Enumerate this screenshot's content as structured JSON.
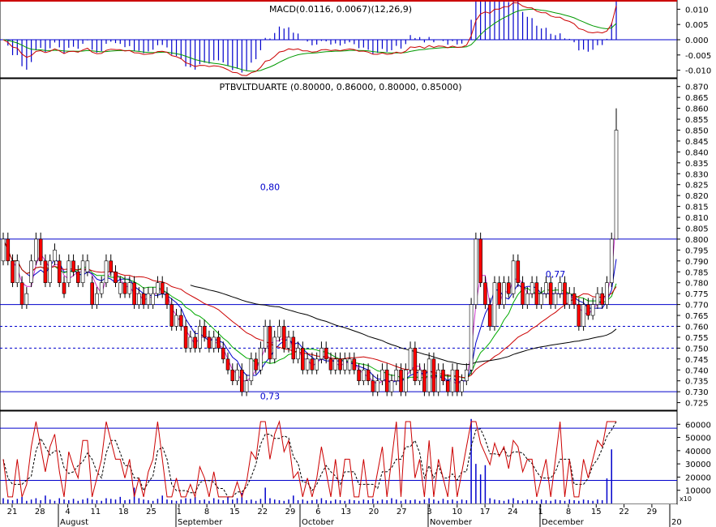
{
  "panels": {
    "macd": {
      "title": "MACD(0.0116, 0.0067)(12,26,9)",
      "y_ticks": [
        0.01,
        0.005,
        0.0,
        -0.005,
        -0.01
      ],
      "ylim": [
        -0.0125,
        0.0125
      ]
    },
    "price": {
      "title": "PTBVLTDUARTE (0.80000, 0.86000, 0.80000, 0.85000)",
      "y_ticks": [
        0.87,
        0.865,
        0.86,
        0.855,
        0.85,
        0.845,
        0.84,
        0.835,
        0.83,
        0.825,
        0.82,
        0.815,
        0.81,
        0.805,
        0.8,
        0.795,
        0.79,
        0.785,
        0.78,
        0.775,
        0.77,
        0.765,
        0.76,
        0.755,
        0.75,
        0.745,
        0.74,
        0.735,
        0.73,
        0.725
      ],
      "ylim": [
        0.7215,
        0.8725
      ],
      "annotations": [
        {
          "text": "0,80",
          "x_date_index": 57,
          "y": 0.8225
        },
        {
          "text": "0,77",
          "x_date_index": 118,
          "y": 0.7825
        },
        {
          "text": "0,73",
          "x_date_index": 57,
          "y": 0.7265
        }
      ],
      "support_resistance_solid": [
        0.8,
        0.77,
        0.73
      ],
      "support_resistance_dashed": [
        0.76,
        0.75
      ]
    },
    "volume": {
      "y_ticks": [
        60000,
        50000,
        40000,
        30000,
        20000,
        10000
      ],
      "multiplier_label": "x10",
      "ylim": [
        0,
        70000
      ],
      "h_lines": [
        57000,
        17500
      ]
    }
  },
  "x_axis": {
    "day_ticks": [
      "21",
      "28",
      "4",
      "11",
      "18",
      "25",
      "1",
      "8",
      "15",
      "22",
      "29",
      "6",
      "13",
      "20",
      "27",
      "3",
      "10",
      "17",
      "24",
      "1",
      "8",
      "15",
      "22",
      "29"
    ],
    "month_labels": [
      "August",
      "September",
      "October",
      "November",
      "December",
      "20"
    ]
  },
  "chart_data": {
    "type": "candlestick",
    "title": "PTBVLTDUARTE (0.80000, 0.86000, 0.80000, 0.85000)",
    "last_bar": {
      "open": 0.8,
      "high": 0.86,
      "low": 0.8,
      "close": 0.85
    },
    "series": [
      {
        "name": "close",
        "values": [
          0.8,
          0.79,
          0.78,
          0.79,
          0.77,
          0.775,
          0.79,
          0.8,
          0.79,
          0.78,
          0.79,
          0.795,
          0.78,
          0.775,
          0.79,
          0.785,
          0.78,
          0.79,
          0.79,
          0.77,
          0.775,
          0.78,
          0.79,
          0.785,
          0.78,
          0.78,
          0.775,
          0.78,
          0.77,
          0.775,
          0.77,
          0.775,
          0.775,
          0.78,
          0.775,
          0.77,
          0.76,
          0.765,
          0.76,
          0.75,
          0.755,
          0.75,
          0.76,
          0.755,
          0.75,
          0.755,
          0.75,
          0.745,
          0.74,
          0.735,
          0.74,
          0.73,
          0.735,
          0.745,
          0.74,
          0.75,
          0.76,
          0.745,
          0.755,
          0.76,
          0.75,
          0.755,
          0.745,
          0.75,
          0.74,
          0.745,
          0.74,
          0.745,
          0.75,
          0.745,
          0.74,
          0.745,
          0.74,
          0.745,
          0.745,
          0.74,
          0.735,
          0.74,
          0.735,
          0.73,
          0.735,
          0.74,
          0.73,
          0.735,
          0.74,
          0.73,
          0.74,
          0.75,
          0.735,
          0.74,
          0.73,
          0.745,
          0.73,
          0.74,
          0.735,
          0.73,
          0.74,
          0.73,
          0.735,
          0.74,
          0.77,
          0.8,
          0.78,
          0.77,
          0.76,
          0.78,
          0.77,
          0.78,
          0.775,
          0.79,
          0.78,
          0.77,
          0.775,
          0.78,
          0.77,
          0.775,
          0.78,
          0.77,
          0.775,
          0.78,
          0.77,
          0.775,
          0.77,
          0.76,
          0.77,
          0.765,
          0.77,
          0.775,
          0.77,
          0.78,
          0.8,
          0.85
        ]
      },
      {
        "name": "open",
        "values": [
          0.79,
          0.8,
          0.79,
          0.78,
          0.78,
          0.77,
          0.78,
          0.79,
          0.8,
          0.79,
          0.78,
          0.79,
          0.79,
          0.78,
          0.78,
          0.79,
          0.785,
          0.78,
          0.785,
          0.78,
          0.77,
          0.775,
          0.78,
          0.79,
          0.785,
          0.775,
          0.78,
          0.775,
          0.78,
          0.77,
          0.775,
          0.77,
          0.77,
          0.775,
          0.78,
          0.775,
          0.77,
          0.76,
          0.765,
          0.76,
          0.75,
          0.755,
          0.75,
          0.76,
          0.755,
          0.75,
          0.755,
          0.75,
          0.745,
          0.74,
          0.735,
          0.74,
          0.73,
          0.735,
          0.745,
          0.74,
          0.75,
          0.76,
          0.745,
          0.755,
          0.76,
          0.75,
          0.755,
          0.745,
          0.75,
          0.74,
          0.745,
          0.74,
          0.745,
          0.75,
          0.745,
          0.74,
          0.745,
          0.74,
          0.74,
          0.745,
          0.74,
          0.735,
          0.74,
          0.735,
          0.73,
          0.735,
          0.74,
          0.73,
          0.735,
          0.74,
          0.73,
          0.74,
          0.75,
          0.735,
          0.74,
          0.73,
          0.745,
          0.73,
          0.74,
          0.735,
          0.73,
          0.74,
          0.73,
          0.735,
          0.74,
          0.77,
          0.8,
          0.78,
          0.77,
          0.76,
          0.78,
          0.77,
          0.78,
          0.775,
          0.79,
          0.78,
          0.77,
          0.775,
          0.78,
          0.77,
          0.775,
          0.78,
          0.77,
          0.775,
          0.78,
          0.77,
          0.775,
          0.77,
          0.76,
          0.77,
          0.765,
          0.77,
          0.775,
          0.77,
          0.78,
          0.8
        ]
      },
      {
        "name": "volume",
        "values": [
          4000,
          3000,
          2500,
          3500,
          5000,
          2000,
          3000,
          4000,
          2500,
          6000,
          3000,
          2000,
          4000,
          3000,
          2500,
          3500,
          2000,
          3000,
          4000,
          3000,
          2500,
          2000,
          4000,
          3500,
          3000,
          5000,
          2500,
          3000,
          12000,
          4000,
          3000,
          2500,
          2000,
          3500,
          6000,
          3000,
          2500,
          2000,
          3000,
          4000,
          3500,
          5000,
          2500,
          3000,
          2000,
          4000,
          3000,
          2500,
          5000,
          3000,
          4000,
          8000,
          2500,
          3000,
          2000,
          3500,
          12000,
          4000,
          3000,
          2500,
          2000,
          3000,
          6000,
          2500,
          3000,
          2000,
          2500,
          3000,
          4000,
          2500,
          2000,
          3000,
          2500,
          2000,
          3000,
          2500,
          2000,
          3000,
          2500,
          3500,
          2000,
          3000,
          2500,
          4000,
          3000,
          2000,
          3000,
          2500,
          3000,
          2000,
          3000,
          4000,
          3000,
          2000,
          3500,
          2500,
          3000,
          2000,
          3000,
          2500,
          64000,
          30000,
          22000,
          29000,
          4000,
          3000,
          2500,
          2000,
          3000,
          4000,
          2500,
          2000,
          3000,
          2500,
          2000,
          3000,
          2500,
          2000,
          3000,
          2500,
          2000,
          3000,
          2500,
          2000,
          3000,
          2500,
          2000,
          3000,
          2500,
          19000,
          41000
        ]
      }
    ],
    "moving_averages": [
      {
        "name": "MA fast",
        "color": "#cc33cc"
      },
      {
        "name": "MA medium",
        "color": "#0000cc"
      },
      {
        "name": "MA slow",
        "color": "#00aa00"
      },
      {
        "name": "MA long",
        "color": "#cc0000"
      },
      {
        "name": "MA very long",
        "color": "#000000"
      }
    ],
    "macd_line": {
      "color": "#cc0000"
    },
    "signal_line": {
      "color": "#009900"
    },
    "histogram": {
      "color": "#0000cc"
    },
    "stochastic": {
      "k_color": "#cc0000",
      "d_color": "#000000"
    },
    "colors": {
      "up": "#ffffff",
      "down": "#ff0000",
      "h_line": "#0000cc",
      "dashed": "#0000cc",
      "annotation": "#0000cc"
    }
  }
}
